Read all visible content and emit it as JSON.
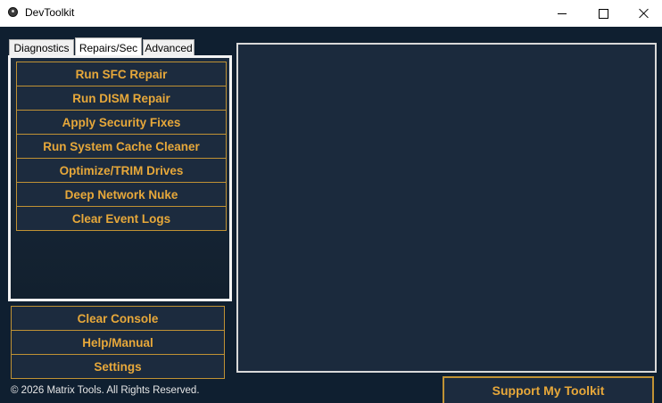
{
  "window": {
    "title": "DevToolkit",
    "controls": {
      "minimize": "minimize-icon",
      "maximize": "maximize-icon",
      "close": "close-icon"
    }
  },
  "tabs": [
    {
      "label": "Diagnostics",
      "selected": false
    },
    {
      "label": "Repairs/Sec",
      "selected": true
    },
    {
      "label": "Advanced",
      "selected": false
    }
  ],
  "repairs": {
    "actions": [
      "Run SFC Repair",
      "Run DISM Repair",
      "Apply Security Fixes",
      "Run System Cache Cleaner",
      "Optimize/TRIM Drives",
      "Deep Network Nuke",
      "Clear Event Logs"
    ]
  },
  "bottom": {
    "clear_console": "Clear Console",
    "help": "Help/Manual",
    "settings": "Settings"
  },
  "footer": {
    "copyright": "© 2026 Matrix Tools. All Rights Reserved.",
    "support": "Support My Toolkit"
  },
  "colors": {
    "background": "#0f1f30",
    "button_bg": "#1c2b3e",
    "accent": "#e7a83a",
    "accent_border": "#c09234"
  }
}
